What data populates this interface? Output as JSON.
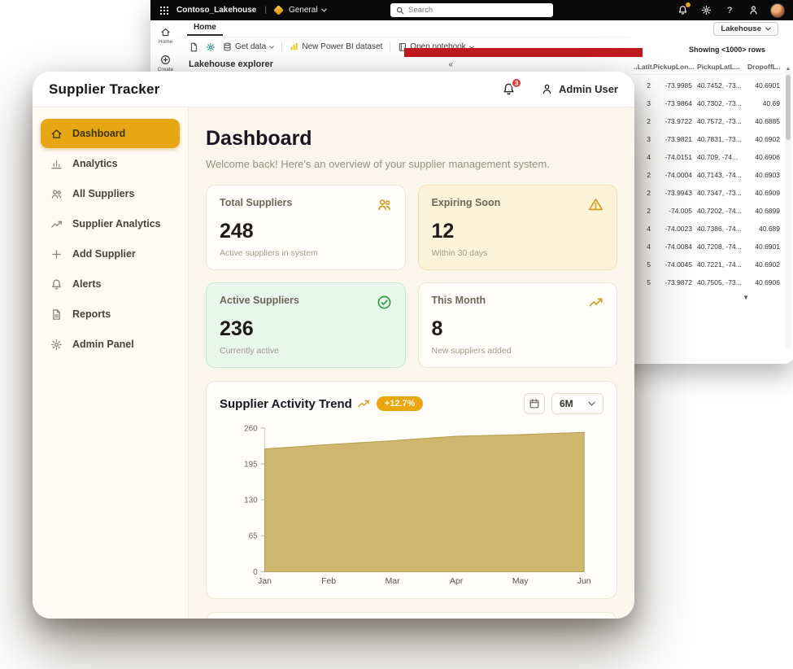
{
  "accent": "#E6A817",
  "fabric": {
    "topbar": {
      "app_name": "Contoso_Lakehouse",
      "separator": "|",
      "workspace_label": "General",
      "search_placeholder": "Search",
      "help_label": "?"
    },
    "rail": {
      "home": "Home",
      "create": "Create"
    },
    "tab_home": "Home",
    "lakehouse_button": "Lakehouse",
    "toolbar": {
      "get_data": "Get data",
      "new_dataset": "New Power BI dataset",
      "open_notebook": "Open notebook"
    },
    "explorer": {
      "title": "Lakehouse explorer",
      "collapse_glyph": "«"
    },
    "table": {
      "showing": "Showing <1000> rows",
      "columns": [
        "..Latit...",
        "PickupLon...",
        "PickupLatL...",
        "DropoffL..."
      ],
      "rows": [
        [
          "2",
          "-73.9985",
          "40.7452, -73...",
          "40.6901"
        ],
        [
          "3",
          "-73.9864",
          "40.7302, -73...",
          "40.69"
        ],
        [
          "2",
          "-73.9722",
          "40.7572, -73...",
          "40.6885"
        ],
        [
          "3",
          "-73.9821",
          "40.7831, -73...",
          "40.6902"
        ],
        [
          "4",
          "-74.0151",
          "40.709, -74...",
          "40.6906"
        ],
        [
          "2",
          "-74.0004",
          "40.7143, -74...",
          "40.6903"
        ],
        [
          "2",
          "-73.9943",
          "40.7347, -73...",
          "40.6909"
        ],
        [
          "2",
          "-74.005",
          "40.7202, -74...",
          "40.6899"
        ],
        [
          "4",
          "-74.0023",
          "40.7386, -74...",
          "40.689"
        ],
        [
          "4",
          "-74.0084",
          "40.7208, -74...",
          "40.6901"
        ],
        [
          "5",
          "-74.0045",
          "40.7221, -74...",
          "40.6902"
        ],
        [
          "5",
          "-73.9872",
          "40.7505, -73...",
          "40.6906"
        ]
      ],
      "scroll_down_glyph": "▼"
    }
  },
  "app": {
    "title": "Supplier Tracker",
    "header": {
      "notification_count": "3",
      "user_name": "Admin User"
    },
    "sidebar": {
      "items": [
        {
          "label": "Dashboard",
          "icon": "home-icon",
          "active": true
        },
        {
          "label": "Analytics",
          "icon": "bar-chart-icon",
          "active": false
        },
        {
          "label": "All Suppliers",
          "icon": "users-icon",
          "active": false
        },
        {
          "label": "Supplier Analytics",
          "icon": "trend-up-icon",
          "active": false
        },
        {
          "label": "Add Supplier",
          "icon": "plus-icon",
          "active": false
        },
        {
          "label": "Alerts",
          "icon": "bell-icon",
          "active": false
        },
        {
          "label": "Reports",
          "icon": "file-icon",
          "active": false
        },
        {
          "label": "Admin Panel",
          "icon": "gear-icon",
          "active": false
        }
      ]
    },
    "page": {
      "title": "Dashboard",
      "subtitle": "Welcome back! Here's an overview of your supplier management system."
    },
    "stat_cards": [
      {
        "label": "Total Suppliers",
        "value": "248",
        "sub": "Active suppliers in system",
        "icon": "users-icon",
        "variant": "plain"
      },
      {
        "label": "Expiring Soon",
        "value": "12",
        "sub": "Within 30 days",
        "icon": "warning-icon",
        "variant": "amber"
      },
      {
        "label": "Active Suppliers",
        "value": "236",
        "sub": "Currently active",
        "icon": "check-circle-icon",
        "variant": "green"
      },
      {
        "label": "This Month",
        "value": "8",
        "sub": "New suppliers added",
        "icon": "trend-up-icon",
        "variant": "plain"
      }
    ],
    "chart_card": {
      "title": "Supplier Activity Trend",
      "badge": "+12.7%",
      "range_value": "6M"
    }
  },
  "chart_data": {
    "type": "area",
    "title": "Supplier Activity Trend",
    "x": [
      "Jan",
      "Feb",
      "Mar",
      "Apr",
      "May",
      "Jun"
    ],
    "values": [
      222,
      230,
      237,
      245,
      248,
      252
    ],
    "xlabel": "",
    "ylabel": "",
    "ylim": [
      0,
      260
    ],
    "yticks": [
      0,
      65,
      130,
      195,
      260
    ],
    "fill": "#CBB164",
    "stroke": "#B59A45",
    "grid": false,
    "legend": "none"
  }
}
